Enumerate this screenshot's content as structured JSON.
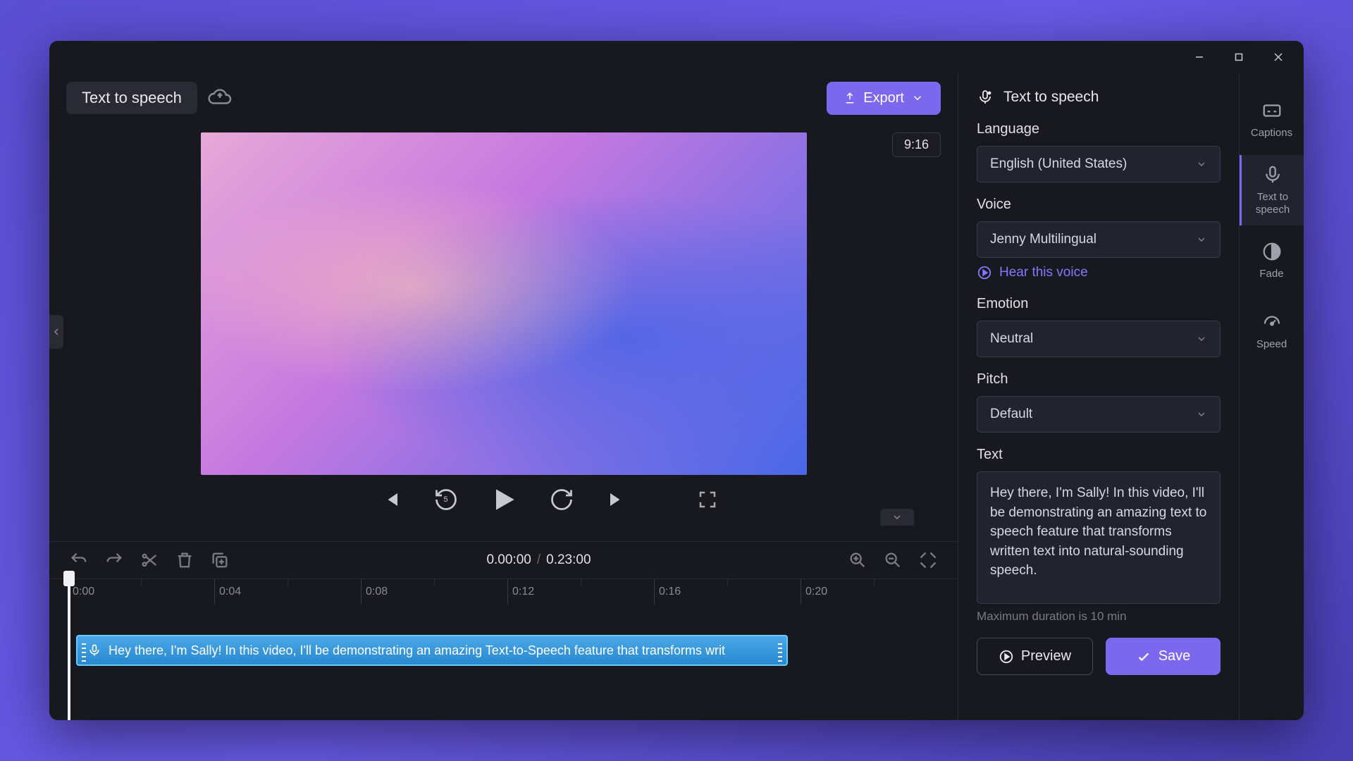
{
  "header": {
    "tts_pill": "Text to speech",
    "export_label": "Export"
  },
  "preview": {
    "aspect_badge": "9:16"
  },
  "timeline": {
    "current_time": "0.00:00",
    "total_time": "0.23:00",
    "ticks": [
      "0:00",
      "0:04",
      "0:08",
      "0:12",
      "0:16",
      "0:20"
    ],
    "clip_text": "Hey there, I'm Sally! In this video, I'll be demonstrating an amazing Text-to-Speech feature that transforms writ"
  },
  "panel": {
    "title": "Text to speech",
    "language_label": "Language",
    "language_value": "English (United States)",
    "voice_label": "Voice",
    "voice_value": "Jenny Multilingual",
    "hear_voice": "Hear this voice",
    "emotion_label": "Emotion",
    "emotion_value": "Neutral",
    "pitch_label": "Pitch",
    "pitch_value": "Default",
    "text_label": "Text",
    "text_value": "Hey there, I'm Sally! In this video, I'll be demonstrating an amazing text to speech feature that transforms written text into natural-sounding speech.",
    "hint": "Maximum duration is 10 min",
    "preview_btn": "Preview",
    "save_btn": "Save"
  },
  "sidetabs": {
    "captions": "Captions",
    "tts": "Text to speech",
    "fade": "Fade",
    "speed": "Speed"
  }
}
